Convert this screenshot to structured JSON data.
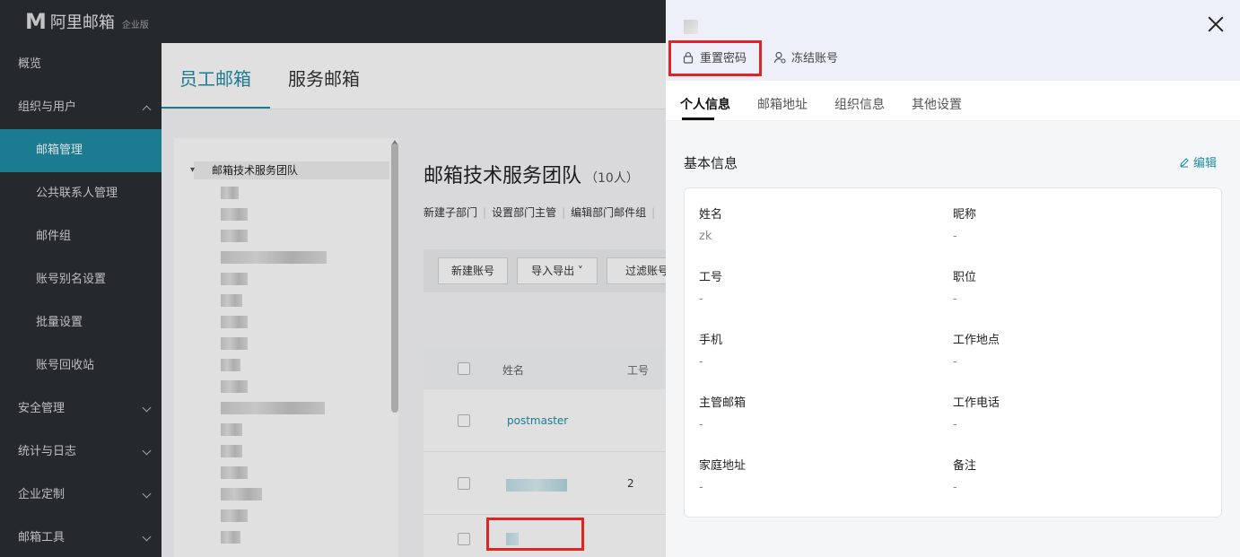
{
  "brand": {
    "logo_mark": "M",
    "name": "阿里邮箱",
    "edition": "企业版"
  },
  "sidebar": {
    "items": [
      {
        "label": "概览"
      },
      {
        "label": "组织与用户"
      },
      {
        "label": "邮箱管理"
      },
      {
        "label": "公共联系人管理"
      },
      {
        "label": "邮件组"
      },
      {
        "label": "账号别名设置"
      },
      {
        "label": "批量设置"
      },
      {
        "label": "账号回收站"
      },
      {
        "label": "安全管理"
      },
      {
        "label": "统计与日志"
      },
      {
        "label": "企业定制"
      },
      {
        "label": "邮箱工具"
      }
    ]
  },
  "main": {
    "tabs": [
      {
        "label": "员工邮箱"
      },
      {
        "label": "服务邮箱"
      }
    ],
    "tree_root": "邮箱技术服务团队",
    "dept": {
      "title": "邮箱技术服务团队",
      "count": "（10人）",
      "actions": [
        "新建子部门",
        "设置部门主管",
        "编辑部门邮件组"
      ]
    },
    "toolbar": {
      "new_account": "新建账号",
      "import_export": "导入导出",
      "filter": "过滤账号"
    },
    "table": {
      "headers": {
        "name": "姓名",
        "id": "工号"
      },
      "rows": [
        {
          "name": "postmaster",
          "id": ""
        },
        {
          "name": "",
          "id": "2"
        },
        {
          "name": "",
          "id": ""
        }
      ]
    }
  },
  "drawer": {
    "actions": {
      "reset_password": "重置密码",
      "freeze_account": "冻结账号"
    },
    "tabs": [
      {
        "label": "个人信息"
      },
      {
        "label": "邮箱地址"
      },
      {
        "label": "组织信息"
      },
      {
        "label": "其他设置"
      }
    ],
    "section_title": "基本信息",
    "edit_label": "编辑",
    "fields": {
      "name": {
        "label": "姓名",
        "value": "zk"
      },
      "nickname": {
        "label": "昵称",
        "value": "-"
      },
      "employee_id": {
        "label": "工号",
        "value": "-"
      },
      "position": {
        "label": "职位",
        "value": "-"
      },
      "mobile": {
        "label": "手机",
        "value": "-"
      },
      "work_location": {
        "label": "工作地点",
        "value": "-"
      },
      "manager_email": {
        "label": "主管邮箱",
        "value": "-"
      },
      "work_phone": {
        "label": "工作电话",
        "value": "-"
      },
      "home_address": {
        "label": "家庭地址",
        "value": "-"
      },
      "remarks": {
        "label": "备注",
        "value": "-"
      }
    }
  },
  "colors": {
    "accent": "#1f8ea5",
    "sidebar_bg": "#2b2f33",
    "highlight": "#e02424"
  }
}
